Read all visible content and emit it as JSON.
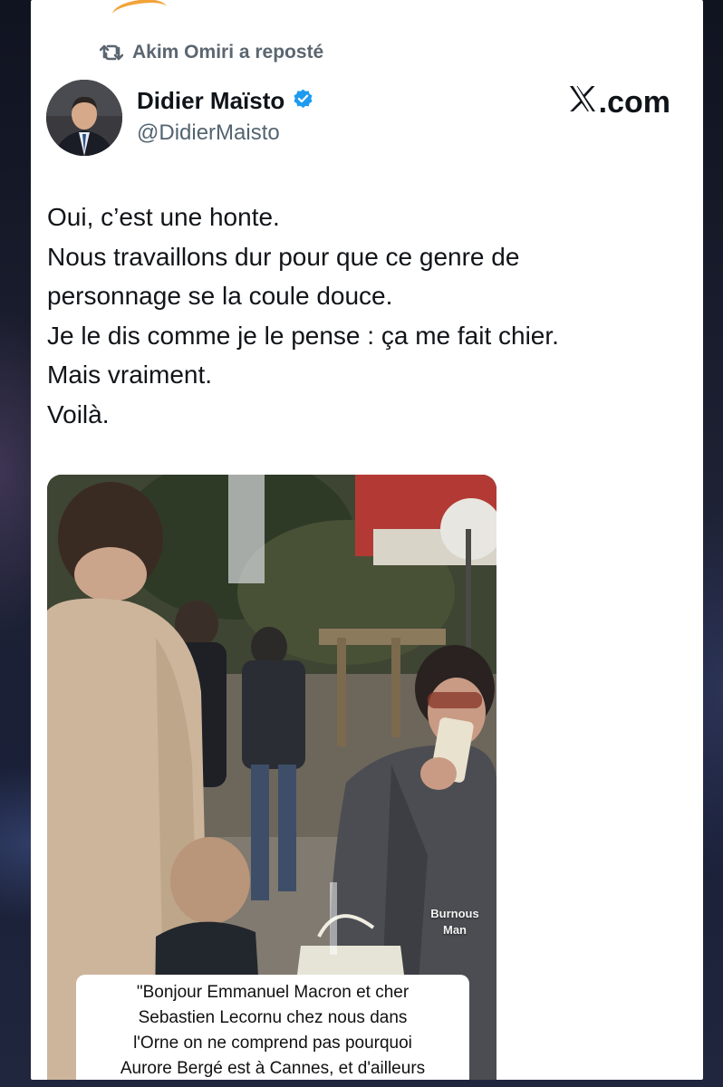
{
  "repost": {
    "icon": "repost-icon",
    "label": "Akim Omiri a reposté"
  },
  "author": {
    "name": "Didier Maïsto",
    "handle": "@DidierMaisto",
    "verified_icon": "verified-badge-icon",
    "verified_color": "#1d9bf0"
  },
  "brand": {
    "logo": "x-logo-icon",
    "label": ".com"
  },
  "tweet": {
    "lines": [
      "Oui, c’est une honte.",
      "Nous travaillons dur pour que ce genre de",
      "personnage se la coule douce.",
      "Je le dis comme je le pense : ça me fait chier.",
      "Mais vraiment.",
      "Voilà."
    ]
  },
  "media": {
    "watermark": "Burnous\nMan",
    "caption_lines": [
      "\"Bonjour Emmanuel Macron et cher",
      "Sebastien Lecornu chez nous dans",
      "l'Orne on ne comprend pas pourquoi",
      "Aurore Bergé est à Cannes, et d'ailleurs"
    ]
  },
  "colors": {
    "text_primary": "#0f1419",
    "text_secondary": "#536471",
    "card_background": "#ffffff"
  }
}
